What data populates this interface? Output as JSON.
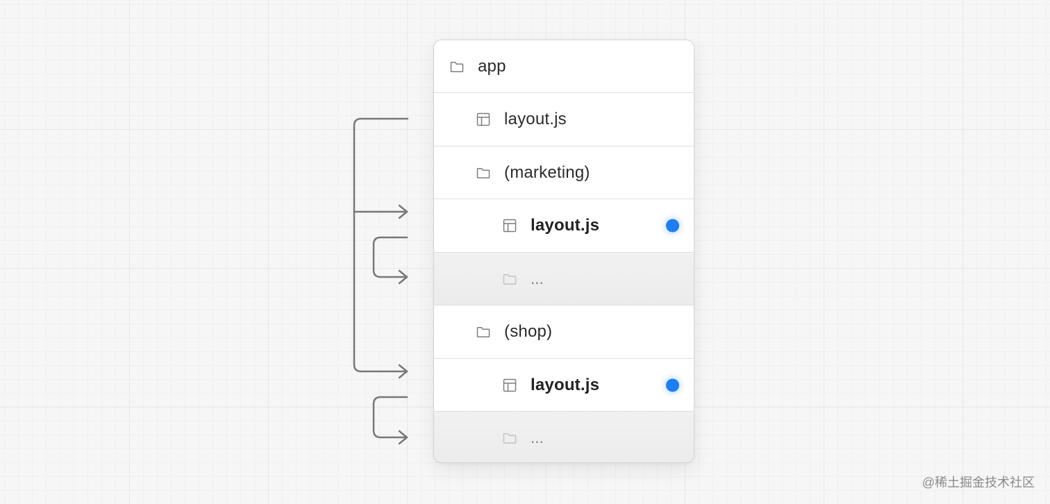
{
  "tree": {
    "rows": [
      {
        "label": "app",
        "icon": "folder-icon",
        "bold": false,
        "active": false
      },
      {
        "label": "layout.js",
        "icon": "layout-icon",
        "bold": false,
        "active": false
      },
      {
        "label": "(marketing)",
        "icon": "folder-icon",
        "bold": false,
        "active": false
      },
      {
        "label": "layout.js",
        "icon": "layout-icon",
        "bold": true,
        "active": true
      },
      {
        "label": "...",
        "icon": "folder-icon",
        "bold": false,
        "active": false
      },
      {
        "label": "(shop)",
        "icon": "folder-icon",
        "bold": false,
        "active": false
      },
      {
        "label": "layout.js",
        "icon": "layout-icon",
        "bold": true,
        "active": true
      },
      {
        "label": "...",
        "icon": "folder-icon",
        "bold": false,
        "active": false
      }
    ]
  },
  "colors": {
    "accent_dot": "#1f7ef0",
    "connector": "#777777"
  },
  "watermark": "@稀土掘金技术社区"
}
